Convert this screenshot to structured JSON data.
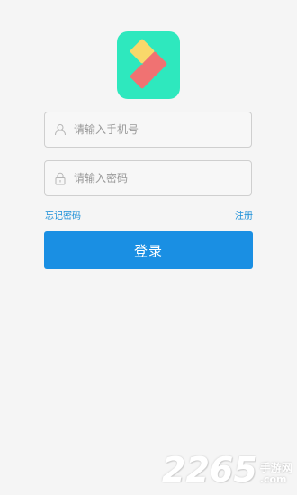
{
  "app": {
    "logo_icon": "app-logo-icon",
    "colors": {
      "logo_bg": "#2ee8be",
      "logo_tile_yellow": "#f9d86a",
      "logo_tile_red": "#f07272",
      "accent": "#1a8fe3"
    }
  },
  "form": {
    "phone_placeholder": "请输入手机号",
    "phone_value": "",
    "phone_icon": "user-icon",
    "password_placeholder": "请输入密码",
    "password_value": "",
    "password_icon": "lock-icon",
    "forgot_label": "忘记密码",
    "register_label": "注册",
    "login_label": "登录"
  },
  "watermark": {
    "number": "2265",
    "text_cn": "手游网",
    "text_com": ".com"
  }
}
